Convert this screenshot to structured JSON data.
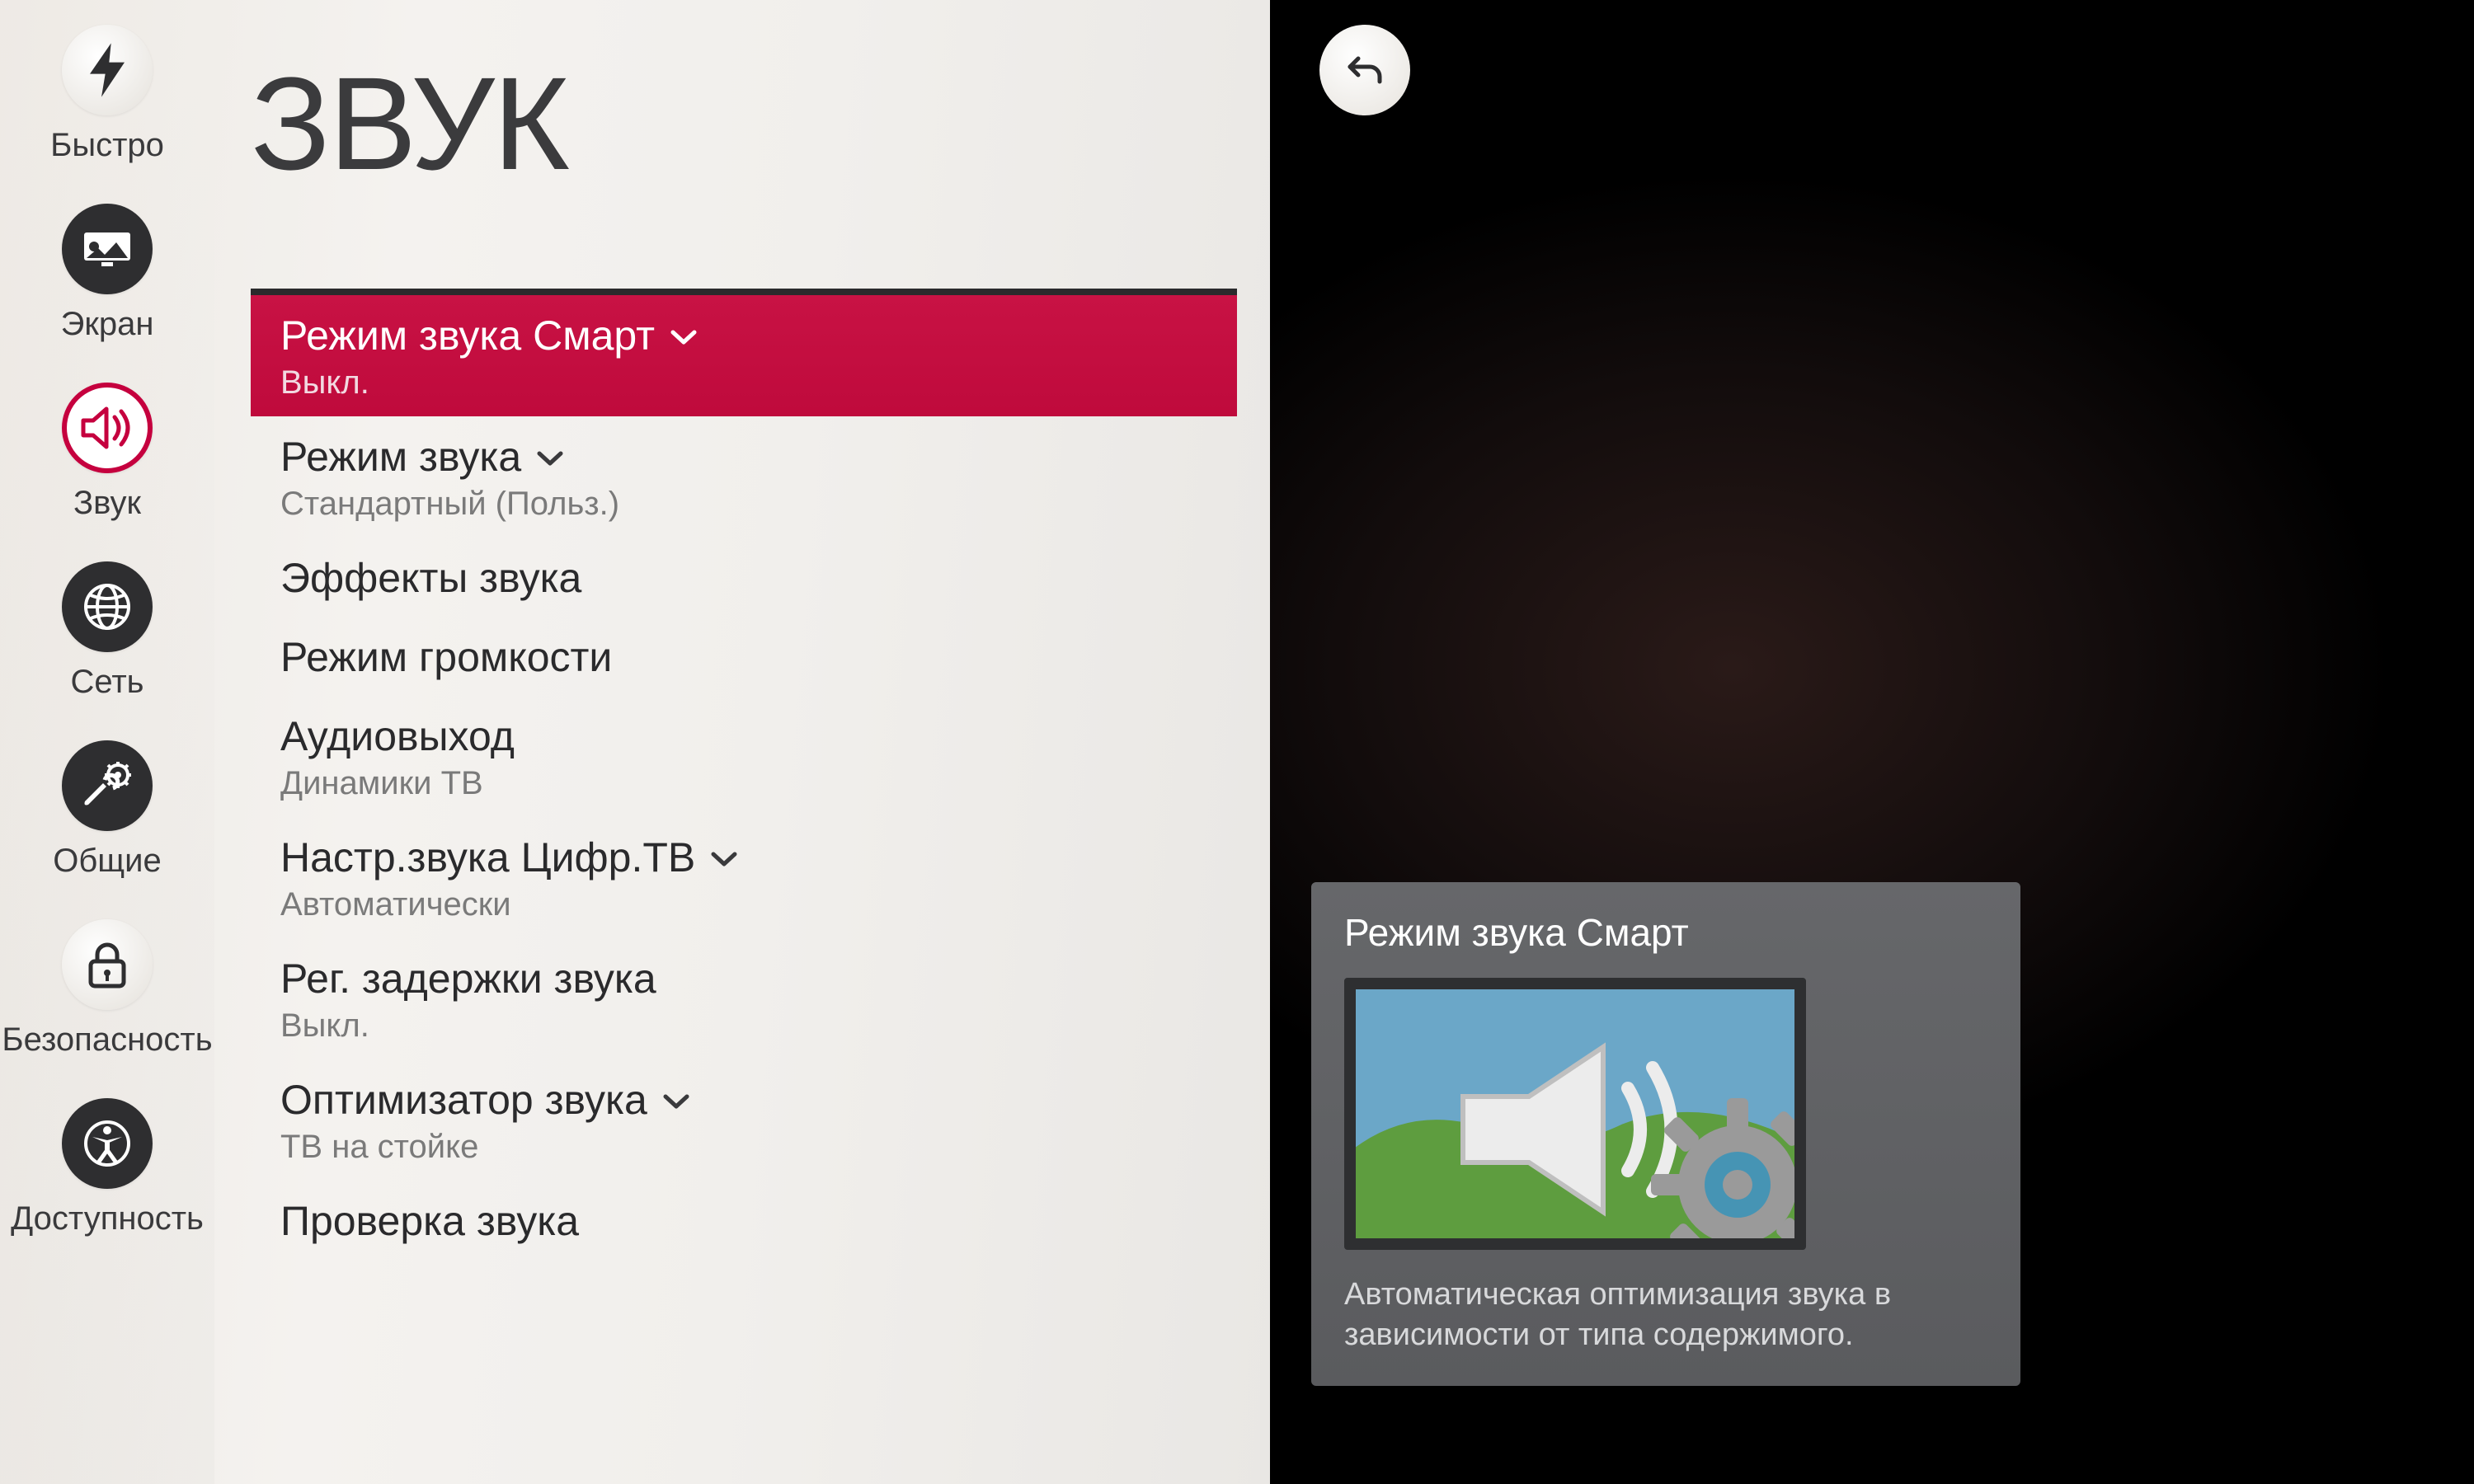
{
  "colors": {
    "accent": "#c30a40"
  },
  "back_button": {
    "name": "back-icon"
  },
  "sidebar": {
    "items": [
      {
        "key": "quick",
        "label": "Быстро",
        "icon": "lightning-icon",
        "selected": false
      },
      {
        "key": "screen",
        "label": "Экран",
        "icon": "screen-icon",
        "selected": false
      },
      {
        "key": "sound",
        "label": "Звук",
        "icon": "sound-icon",
        "selected": true
      },
      {
        "key": "network",
        "label": "Сеть",
        "icon": "globe-icon",
        "selected": false
      },
      {
        "key": "general",
        "label": "Общие",
        "icon": "wrench-gear-icon",
        "selected": false
      },
      {
        "key": "security",
        "label": "Безопасность",
        "icon": "lock-icon",
        "selected": false
      },
      {
        "key": "accessibility",
        "label": "Доступность",
        "icon": "accessibility-icon",
        "selected": false
      }
    ]
  },
  "page": {
    "title": "ЗВУК"
  },
  "menu": {
    "items": [
      {
        "title": "Режим звука Смарт",
        "sub": "Выкл.",
        "chevron": true,
        "selected": true
      },
      {
        "title": "Режим звука",
        "sub": "Стандартный (Польз.)",
        "chevron": true,
        "selected": false
      },
      {
        "title": "Эффекты звука",
        "sub": "",
        "chevron": false,
        "selected": false
      },
      {
        "title": "Режим громкости",
        "sub": "",
        "chevron": false,
        "selected": false
      },
      {
        "title": "Аудиовыход",
        "sub": "Динамики ТВ",
        "chevron": false,
        "selected": false
      },
      {
        "title": "Настр.звука Цифр.ТВ",
        "sub": "Автоматически",
        "chevron": true,
        "selected": false
      },
      {
        "title": "Рег. задержки звука",
        "sub": "Выкл.",
        "chevron": false,
        "selected": false
      },
      {
        "title": "Оптимизатор звука",
        "sub": "ТВ на стойке",
        "chevron": true,
        "selected": false
      },
      {
        "title": "Проверка звука",
        "sub": "",
        "chevron": false,
        "selected": false
      }
    ]
  },
  "info_card": {
    "title": "Режим звука Смарт",
    "description": "Автоматическая оптимизация звука в зависимости от типа содержимого."
  }
}
